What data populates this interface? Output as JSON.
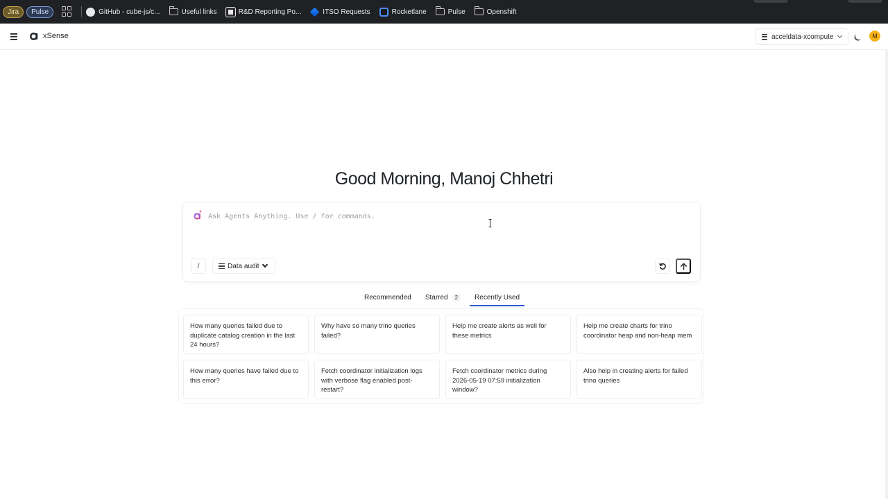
{
  "bookmarks": {
    "pills": [
      "Jira",
      "Pulse"
    ],
    "items": [
      {
        "label": "GitHub - cube-js/c...",
        "icon": "github-icon"
      },
      {
        "label": "Useful links",
        "icon": "folder-icon"
      },
      {
        "label": "R&D Reporting Po...",
        "icon": "app-square-icon"
      },
      {
        "label": "ITSO Requests",
        "icon": "jira-icon"
      },
      {
        "label": "Rocketlane",
        "icon": "rocketlane-icon"
      },
      {
        "label": "Pulse",
        "icon": "folder-icon"
      },
      {
        "label": "Openshift",
        "icon": "folder-icon"
      }
    ]
  },
  "header": {
    "app_name": "xSense",
    "environment": "acceldata-xcompute",
    "avatar_initial": "M"
  },
  "main": {
    "greeting": "Good Morning, Manoj Chhetri",
    "prompt": {
      "placeholder": "Ask Agents Anything. Use / for commands.",
      "value": "",
      "slash_label": "/",
      "mode_label": "Data audit"
    },
    "tabs": [
      {
        "label": "Recommended",
        "badge": "",
        "active": false
      },
      {
        "label": "Starred",
        "badge": "2",
        "active": false
      },
      {
        "label": "Recently Used",
        "badge": "",
        "active": true
      }
    ],
    "suggestions": [
      "How many queries failed due to duplicate catalog creation in the last 24 hours?",
      "Why have so many trino queries failed?",
      "Help me create alerts as well for these metrics",
      "Help me create charts for trino coordinator heap and non-heap mem",
      "How many queries have failed due to this error?",
      "Fetch coordinator initialization logs with verbose flag enabled post-restart?",
      "Fetch coordinator metrics during 2026-05-19 07:59 initialization window?",
      "Also help in creating alerts for failed trino queries"
    ]
  },
  "colors": {
    "accent": "#2f5bd3",
    "avatar_bg": "#f5b21b",
    "bookmark_bar": "#202124"
  }
}
